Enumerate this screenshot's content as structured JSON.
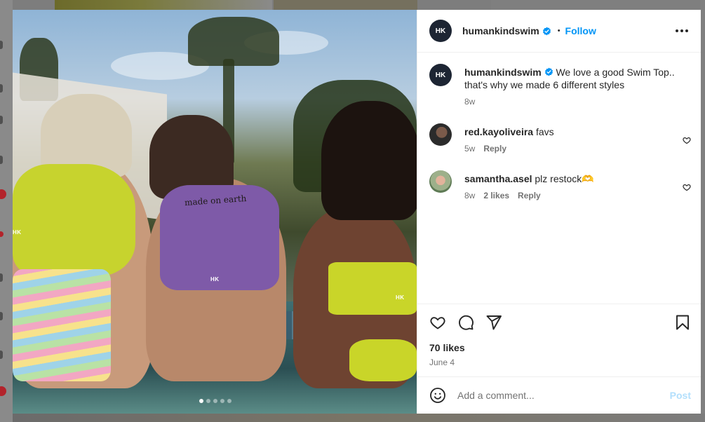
{
  "post": {
    "author": "humankindswim",
    "avatar_initials": "HK",
    "follow_label": "Follow",
    "separator": "•",
    "caption": "We love a good Swim Top.. that's why we made 6 different styles",
    "caption_age": "8w",
    "tattoo_text": "made on earth",
    "brand_mark": "HK",
    "likes": "70 likes",
    "date": "June 4",
    "slide_count": 5,
    "active_slide": 1
  },
  "comments": [
    {
      "user": "red.kayoliveira",
      "text": "favs",
      "age": "5w",
      "likes": "",
      "reply_label": "Reply"
    },
    {
      "user": "samantha.asel",
      "text": "plz restock🫶",
      "age": "8w",
      "likes": "2 likes",
      "reply_label": "Reply"
    }
  ],
  "add_comment": {
    "placeholder": "Add a comment...",
    "post_label": "Post"
  },
  "colors": {
    "accent": "#0095f6",
    "verified": "#0095f6",
    "post_disabled": "#b2dffc"
  },
  "icons": [
    "verified-badge-icon",
    "more-options-icon",
    "heart-icon",
    "comment-icon",
    "share-icon",
    "bookmark-icon",
    "emoji-icon"
  ]
}
